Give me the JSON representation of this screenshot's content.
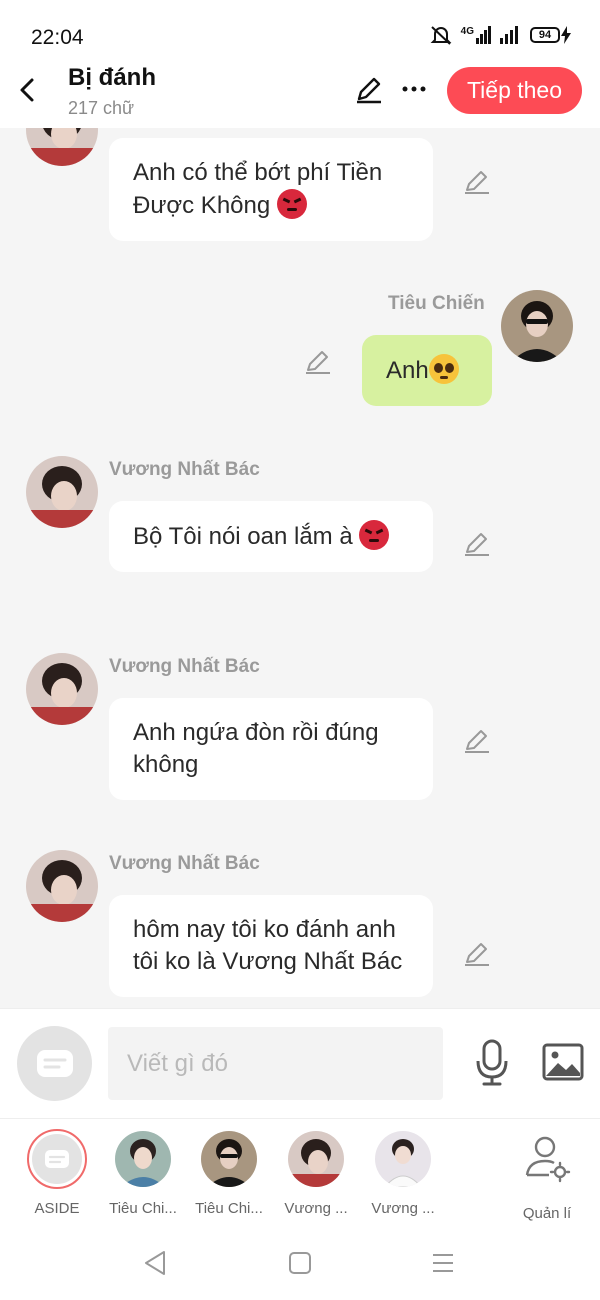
{
  "status_bar": {
    "time": "22:04",
    "network": "4G",
    "battery": "94"
  },
  "header": {
    "title": "Bị đánh",
    "subtitle": "217 chữ",
    "next_label": "Tiếp theo"
  },
  "messages": [
    {
      "sender": "",
      "text": "Anh có thể bớt phí Tiền Được Không",
      "emoji": "angry-face",
      "side": "left"
    },
    {
      "sender": "Tiêu Chiến",
      "text": "Anh",
      "emoji": "pleading-face",
      "side": "right"
    },
    {
      "sender": "Vương Nhất Bác",
      "text": "Bộ Tôi nói oan lắm à",
      "emoji": "angry-face",
      "side": "left"
    },
    {
      "sender": "Vương Nhất Bác",
      "text": "Anh ngứa đòn rồi đúng không",
      "emoji": "",
      "side": "left"
    },
    {
      "sender": "Vương Nhất Bác",
      "text": "hôm nay tôi ko đánh anh tôi ko là Vương Nhất Bác",
      "emoji": "",
      "side": "left"
    }
  ],
  "input": {
    "placeholder": "Viết gì đó"
  },
  "characters": [
    {
      "label": "ASIDE"
    },
    {
      "label": "Tiêu Chi..."
    },
    {
      "label": "Tiêu Chi..."
    },
    {
      "label": "Vương ..."
    },
    {
      "label": "Vương ..."
    },
    {
      "label": "Quản lí"
    }
  ],
  "colors": {
    "accent": "#fd4b55",
    "self_bubble": "#d7f1a0",
    "other_bubble": "#ffffff",
    "background": "#f5f5f5"
  },
  "icons": [
    "back-arrow-icon",
    "pencil-icon",
    "more-dots-icon",
    "chat-bubble-icon",
    "microphone-icon",
    "image-icon",
    "user-gear-icon",
    "nav-back-icon",
    "nav-home-icon",
    "nav-menu-icon"
  ]
}
